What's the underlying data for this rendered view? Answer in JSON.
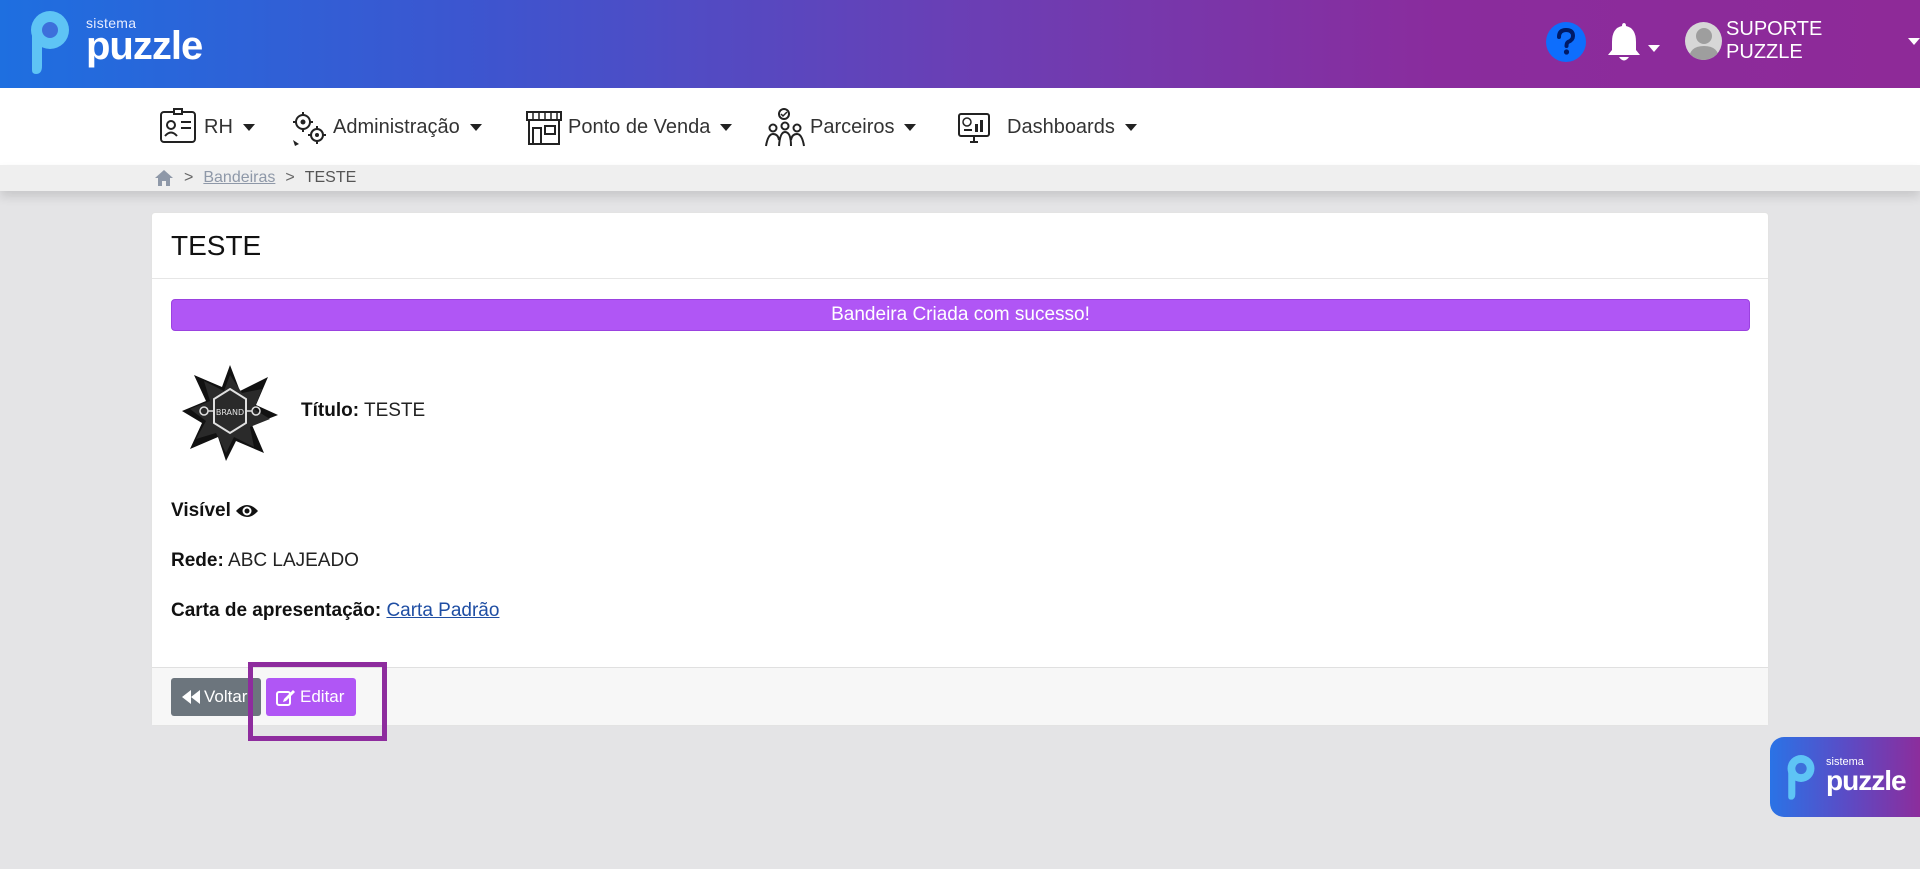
{
  "brand": {
    "small": "sistema",
    "big": "puzzle"
  },
  "header": {
    "user_name": "SUPORTE PUZZLE"
  },
  "nav": [
    {
      "label": "RH"
    },
    {
      "label": "Administração"
    },
    {
      "label": "Ponto de Venda"
    },
    {
      "label": "Parceiros"
    },
    {
      "label": "Dashboards"
    }
  ],
  "breadcrumb": {
    "section": "Bandeiras",
    "current": "TESTE"
  },
  "card": {
    "title": "TESTE",
    "alert": "Bandeira Criada com sucesso!",
    "brand_logo_text": "BRAND",
    "titulo_label": "Título:",
    "titulo_value": "TESTE",
    "visivel_label": "Visível",
    "rede_label": "Rede:",
    "rede_value": "ABC LAJEADO",
    "carta_label": "Carta de apresentação:",
    "carta_value": "Carta Padrão"
  },
  "buttons": {
    "back": "Voltar",
    "edit": "Editar"
  },
  "colors": {
    "accent": "#b056f5",
    "highlight": "#8e2c9e",
    "secondary": "#6c757d"
  }
}
